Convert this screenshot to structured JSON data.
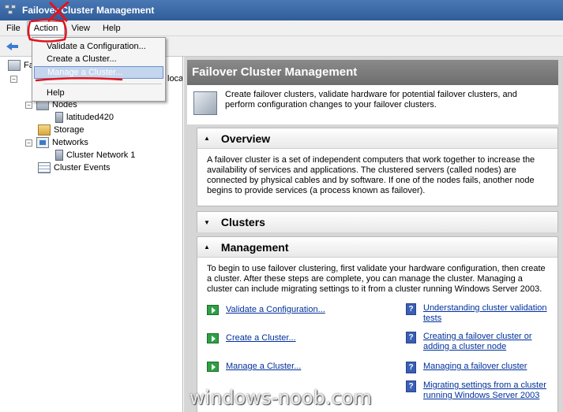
{
  "window": {
    "title": "Failover Cluster Management"
  },
  "menubar": {
    "file": "File",
    "action": "Action",
    "view": "View",
    "help": "Help"
  },
  "action_menu": {
    "items": [
      "Validate a Configuration...",
      "Create a Cluster...",
      "Manage a Cluster...",
      "Help"
    ],
    "highlighted_index": 2
  },
  "tree": {
    "root_label": "Fa",
    "root_suffix": "loca",
    "nodes": "Nodes",
    "node_child": "latituded420",
    "storage": "Storage",
    "networks": "Networks",
    "network_child": "Cluster Network 1",
    "events": "Cluster Events"
  },
  "content": {
    "title": "Failover Cluster Management",
    "intro": "Create failover clusters, validate hardware for potential failover clusters, and perform configuration changes to your failover clusters.",
    "overview": {
      "title": "Overview",
      "text": "A failover cluster is a set of independent computers that work together to increase the availability of services and applications. The clustered servers (called nodes) are connected by physical cables and by software. If one of the nodes fails, another node begins to provide services (a process known as failover)."
    },
    "clusters": {
      "title": "Clusters"
    },
    "management": {
      "title": "Management",
      "text": "To begin to use failover clustering, first validate your hardware configuration, then create a cluster.  After these steps are complete, you can manage the cluster.  Managing a cluster can include migrating settings to it from a cluster running Windows Server 2003.",
      "actions": [
        "Validate a Configuration...",
        "Create a Cluster...",
        "Manage a Cluster..."
      ],
      "help_links": [
        "Understanding cluster validation tests",
        "Creating a failover cluster or adding a cluster node",
        "Managing a failover cluster",
        "Migrating settings from a cluster running Windows Server 2003"
      ]
    }
  },
  "watermark": "windows-noob.com",
  "colors": {
    "title_bar": "#3a6aa8",
    "link": "#00309c",
    "annotation": "#e0141e",
    "highlight": "#c4d5ee"
  }
}
